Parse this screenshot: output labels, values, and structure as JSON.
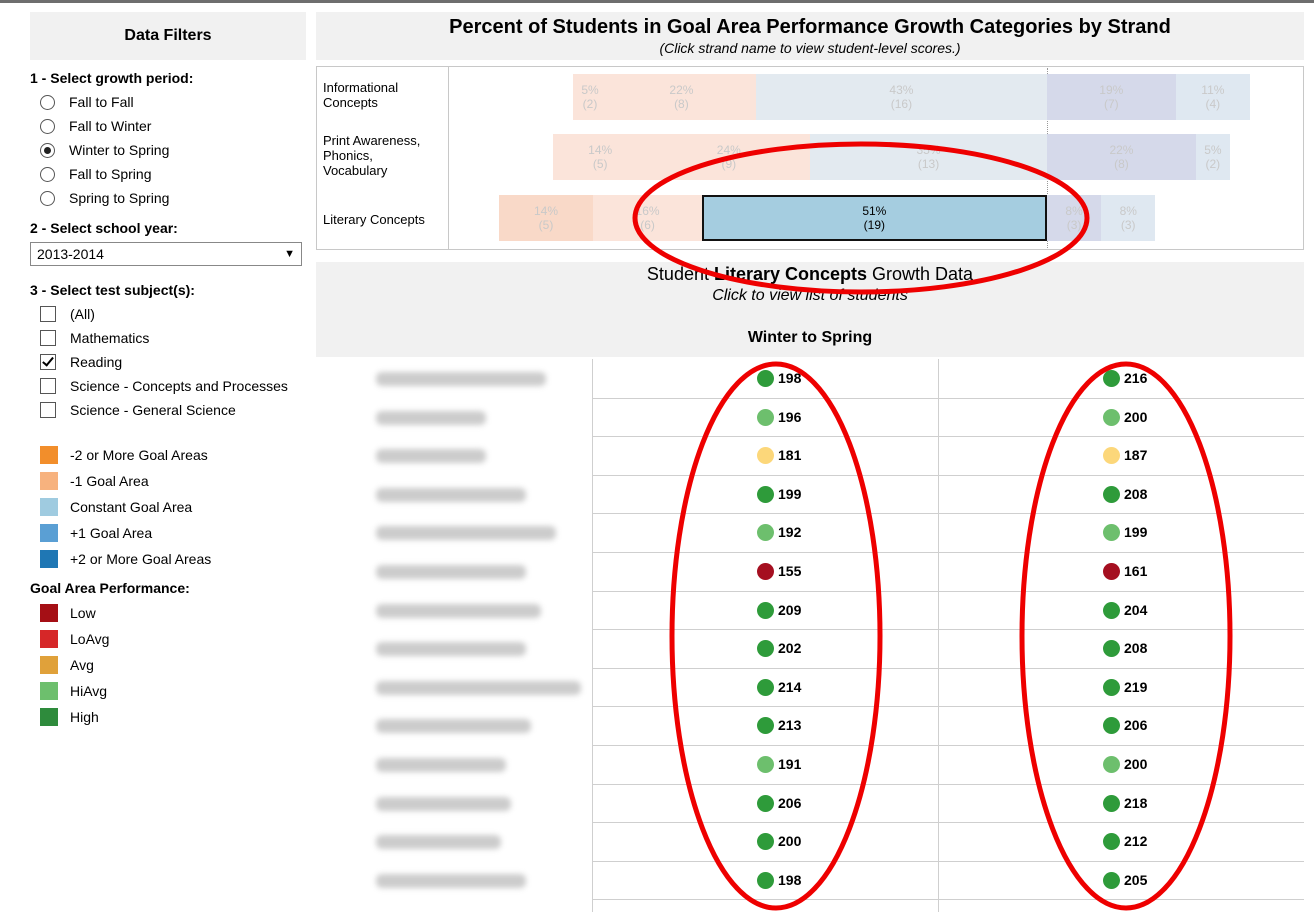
{
  "filters": {
    "title": "Data Filters",
    "growth_period": {
      "label": "1 - Select growth period:",
      "options": [
        "Fall to Fall",
        "Fall to Winter",
        "Winter to Spring",
        "Fall to Spring",
        "Spring to Spring"
      ],
      "selected": "Winter to Spring"
    },
    "school_year": {
      "label": "2 - Select school year:",
      "value": "2013-2014"
    },
    "test_subjects": {
      "label": "3 - Select test subject(s):",
      "options": [
        "(All)",
        "Mathematics",
        "Reading",
        "Science - Concepts and Processes",
        "Science - General Science"
      ],
      "checked": [
        "Reading"
      ]
    }
  },
  "growth_legend": [
    {
      "label": "-2 or More Goal Areas",
      "color": "#f28e2b"
    },
    {
      "label": "-1 Goal Area",
      "color": "#f7b27e"
    },
    {
      "label": "Constant Goal Area",
      "color": "#9fcbe0"
    },
    {
      "label": "+1 Goal Area",
      "color": "#5a9fd4"
    },
    {
      "label": "+2 or More Goal Areas",
      "color": "#1f77b4"
    }
  ],
  "performance_legend": {
    "title": "Goal Area Performance:",
    "items": [
      {
        "label": "Low",
        "color": "#a50f15"
      },
      {
        "label": "LoAvg",
        "color": "#d62728"
      },
      {
        "label": "Avg",
        "color": "#e0a13a"
      },
      {
        "label": "HiAvg",
        "color": "#6dbf6d"
      },
      {
        "label": "High",
        "color": "#2e8b3c"
      }
    ]
  },
  "chart": {
    "title": "Percent of Students in Goal Area Performance Growth Categories by Strand",
    "subtitle": "(Click strand name to view student-level scores.)"
  },
  "chart_data": {
    "type": "bar",
    "stacked": true,
    "orientation": "horizontal",
    "categories": [
      "Informational Concepts",
      "Print Awareness, Phonics, Vocabulary",
      "Literary Concepts"
    ],
    "series": [
      {
        "name": "-2 or More Goal Areas",
        "percent": [
          null,
          null,
          14
        ],
        "count": [
          null,
          null,
          5
        ]
      },
      {
        "name": "-1 Goal Area",
        "percent": [
          5,
          14,
          16
        ],
        "count": [
          2,
          5,
          6
        ]
      },
      {
        "name": "-1 Goal Area",
        "percent": [
          22,
          24,
          null
        ],
        "count": [
          8,
          9,
          null
        ]
      },
      {
        "name": "Constant Goal Area",
        "percent": [
          43,
          35,
          51
        ],
        "count": [
          16,
          13,
          19
        ]
      },
      {
        "name": "+1 Goal Area",
        "percent": [
          19,
          22,
          8
        ],
        "count": [
          7,
          8,
          3
        ]
      },
      {
        "name": "+2 or More Goal Areas",
        "percent": [
          11,
          5,
          8
        ],
        "count": [
          4,
          2,
          3
        ]
      }
    ],
    "highlighted": {
      "category": "Literary Concepts",
      "series": "Constant Goal Area",
      "label": "51%",
      "count_label": "(19)"
    }
  },
  "growth_section": {
    "title_prefix": "Student ",
    "title_bold": "Literary Concepts",
    "title_suffix": " Growth Data",
    "subtitle": "Click to view list of students",
    "period": "Winter to Spring"
  },
  "students": [
    {
      "start": 198,
      "start_level": "High",
      "end": 216,
      "end_level": "High"
    },
    {
      "start": 196,
      "start_level": "HiAvg",
      "end": 200,
      "end_level": "HiAvg"
    },
    {
      "start": 181,
      "start_level": "Avg",
      "end": 187,
      "end_level": "Avg"
    },
    {
      "start": 199,
      "start_level": "High",
      "end": 208,
      "end_level": "High"
    },
    {
      "start": 192,
      "start_level": "HiAvg",
      "end": 199,
      "end_level": "HiAvg"
    },
    {
      "start": 155,
      "start_level": "Low",
      "end": 161,
      "end_level": "Low"
    },
    {
      "start": 209,
      "start_level": "High",
      "end": 204,
      "end_level": "High"
    },
    {
      "start": 202,
      "start_level": "High",
      "end": 208,
      "end_level": "High"
    },
    {
      "start": 214,
      "start_level": "High",
      "end": 219,
      "end_level": "High"
    },
    {
      "start": 213,
      "start_level": "High",
      "end": 206,
      "end_level": "High"
    },
    {
      "start": 191,
      "start_level": "HiAvg",
      "end": 200,
      "end_level": "HiAvg"
    },
    {
      "start": 206,
      "start_level": "High",
      "end": 218,
      "end_level": "High"
    },
    {
      "start": 200,
      "start_level": "High",
      "end": 212,
      "end_level": "High"
    },
    {
      "start": 198,
      "start_level": "High",
      "end": 205,
      "end_level": "High"
    }
  ],
  "dot_colors": {
    "High": "#2e9b3a",
    "HiAvg": "#6dbf6d",
    "Avg": "#fcd77a",
    "Low": "#a50f20"
  }
}
